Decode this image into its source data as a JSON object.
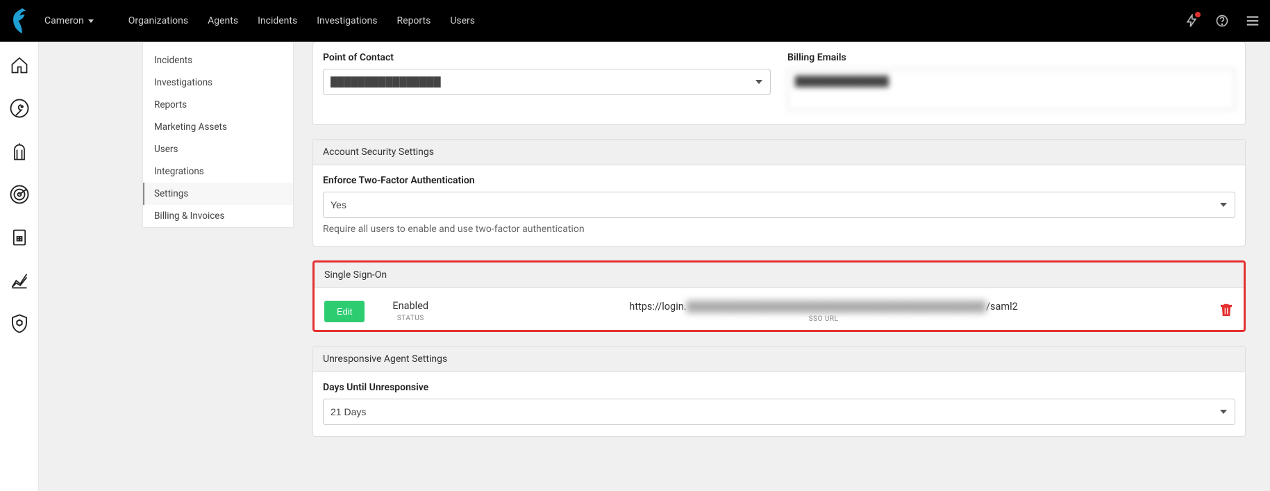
{
  "topbar": {
    "user": "Cameron",
    "links": [
      "Organizations",
      "Agents",
      "Incidents",
      "Investigations",
      "Reports",
      "Users"
    ]
  },
  "sidemenu": {
    "items": [
      {
        "label": "Incidents",
        "active": false
      },
      {
        "label": "Investigations",
        "active": false
      },
      {
        "label": "Reports",
        "active": false
      },
      {
        "label": "Marketing Assets",
        "active": false
      },
      {
        "label": "Users",
        "active": false
      },
      {
        "label": "Integrations",
        "active": false
      },
      {
        "label": "Settings",
        "active": true
      },
      {
        "label": "Billing & Invoices",
        "active": false
      }
    ]
  },
  "contact": {
    "poc_label": "Point of Contact",
    "poc_value": "████████████████",
    "billing_label": "Billing Emails",
    "billing_value": "████████████████"
  },
  "security": {
    "header": "Account Security Settings",
    "twofa_label": "Enforce Two-Factor Authentication",
    "twofa_value": "Yes",
    "twofa_help": "Require all users to enable and use two-factor authentication"
  },
  "sso": {
    "header": "Single Sign-On",
    "edit_label": "Edit",
    "status_value": "Enabled",
    "status_label": "STATUS",
    "url_prefix": "https://login.",
    "url_suffix": "/saml2",
    "url_label": "SSO URL"
  },
  "unresponsive": {
    "header": "Unresponsive Agent Settings",
    "days_label": "Days Until Unresponsive",
    "days_value": "21 Days"
  },
  "colors": {
    "highlight_border": "#e43030",
    "btn_green": "#2ecc71",
    "trash_red": "#e43030"
  }
}
